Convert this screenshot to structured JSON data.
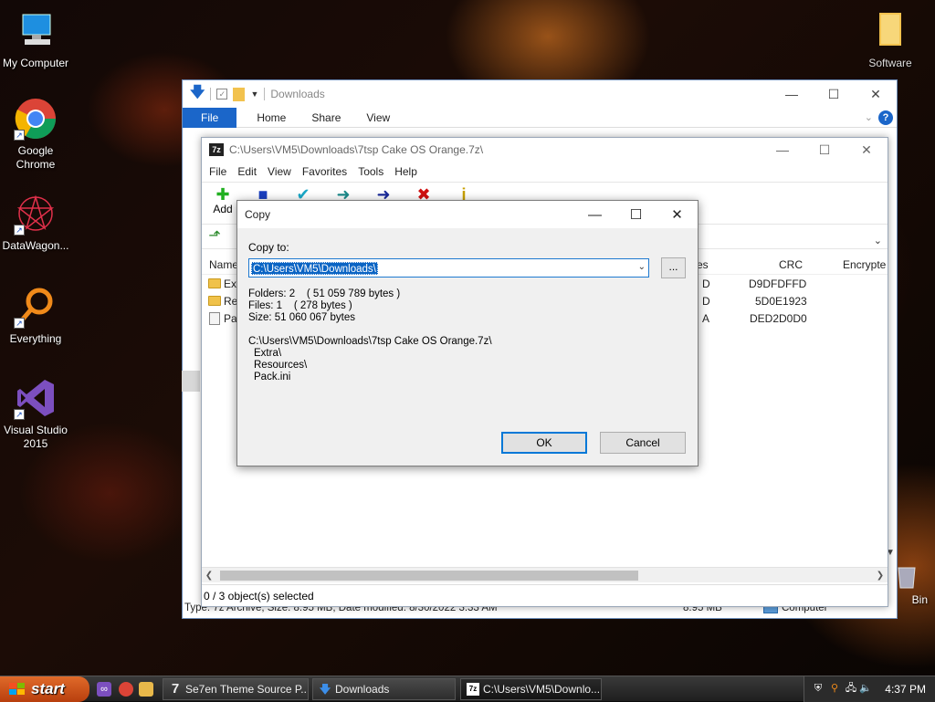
{
  "desktop": {
    "icons": [
      {
        "label": "My Computer"
      },
      {
        "label": "Google Chrome"
      },
      {
        "label": "DataWagon..."
      },
      {
        "label": "Everything"
      },
      {
        "label": "Visual Studio 2015"
      },
      {
        "label": "Software"
      },
      {
        "label": "Bin"
      }
    ]
  },
  "explorer": {
    "title": "Downloads",
    "ribbon_tabs": [
      "File",
      "Home",
      "Share",
      "View"
    ],
    "status": "Type: 7z Archive, Size: 8.95 MB, Date modified: 8/30/2022 3:33 AM",
    "status_size": "8.95 MB",
    "status_location": "Computer"
  },
  "sevenzip": {
    "title": "C:\\Users\\VM5\\Downloads\\7tsp Cake OS Orange.7z\\",
    "menu": [
      "File",
      "Edit",
      "View",
      "Favorites",
      "Tools",
      "Help"
    ],
    "toolbar": {
      "add_label": "Add"
    },
    "columns": {
      "name": "Name",
      "attributes": "es",
      "crc": "CRC",
      "encrypted": "Encrypte"
    },
    "rows": [
      {
        "name": "Ext",
        "attr": "D",
        "crc": "D9DFDFFD"
      },
      {
        "name": "Res",
        "attr": "D",
        "crc": "5D0E1923"
      },
      {
        "name": "Pac",
        "attr": "A",
        "crc": "DED2D0D0"
      }
    ],
    "status": "0 / 3 object(s) selected"
  },
  "copy_dialog": {
    "title": "Copy",
    "copy_to_label": "Copy to:",
    "path_value": "C:\\Users\\VM5\\Downloads\\",
    "browse_label": "...",
    "folders_line": "Folders: 2    ( 51 059 789 bytes )",
    "files_line": "Files: 1    ( 278 bytes )",
    "size_line": "Size: 51 060 067 bytes",
    "source_path": "C:\\Users\\VM5\\Downloads\\7tsp Cake OS Orange.7z\\",
    "items": [
      "Extra\\",
      "Resources\\",
      "Pack.ini"
    ],
    "ok_label": "OK",
    "cancel_label": "Cancel"
  },
  "taskbar": {
    "start_label": "start",
    "tasks": [
      {
        "label": "Se7en Theme Source P..."
      },
      {
        "label": "Downloads"
      },
      {
        "label": "C:\\Users\\VM5\\Downlo..."
      }
    ],
    "clock": "4:37 PM"
  },
  "colors": {
    "accent": "#1b66c9",
    "selection": "#0a64c4",
    "start_button": "#d0561c"
  }
}
